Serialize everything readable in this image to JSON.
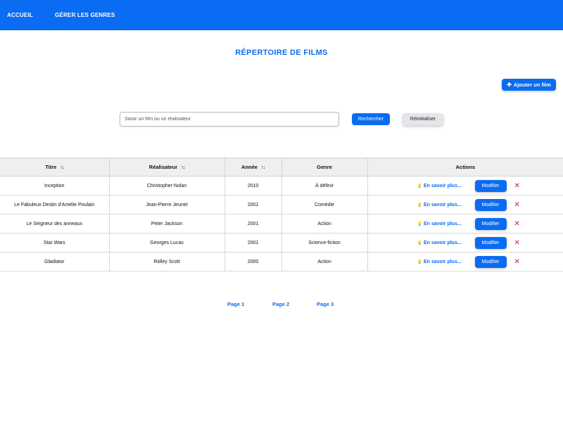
{
  "nav": {
    "home": "ACCUEIL",
    "genres": "GÉRER LES GENRES"
  },
  "page": {
    "title": "RÉPERTOIRE DE FILMS",
    "add_button": "Ajouter un film"
  },
  "search": {
    "placeholder": "Saisir un film ou un réalisateur",
    "value": "",
    "submit_label": "Rechercher",
    "reset_label": "Réinitialiser"
  },
  "table": {
    "headers": {
      "title": "Titre",
      "director": "Réalisateur",
      "year": "Année",
      "genre": "Genre",
      "actions": "Actions"
    },
    "sort_symbol": "↑↓",
    "rows": [
      {
        "title": "Inception",
        "director": "Christopher Nolan",
        "year": "2010",
        "genre": "À définir"
      },
      {
        "title": "Le Fabuleux Destin d'Amélie Poulain",
        "director": "Jean-Pierre Jeunet",
        "year": "2001",
        "genre": "Comédie"
      },
      {
        "title": "Le Seigneur des anneaux",
        "director": "Peter Jackson",
        "year": "2001",
        "genre": "Action"
      },
      {
        "title": "Star Wars",
        "director": "Georges Lucas",
        "year": "2001",
        "genre": "Science-fiction"
      },
      {
        "title": "Gladiator",
        "director": "Ridley Scott",
        "year": "2000",
        "genre": "Action"
      }
    ],
    "info_label": "En savoir plus...",
    "edit_label": "Modifier",
    "delete_symbol": "✕"
  },
  "pagination": {
    "pages": [
      "Page 1",
      "Page 2",
      "Page 3"
    ]
  },
  "colors": {
    "primary": "#0a6cf2",
    "danger": "#d32020",
    "header_bg": "#efefef"
  },
  "icons": {
    "add": "plus-icon",
    "info": "lightbulb-icon",
    "delete": "close-icon",
    "sort": "sort-icon"
  }
}
